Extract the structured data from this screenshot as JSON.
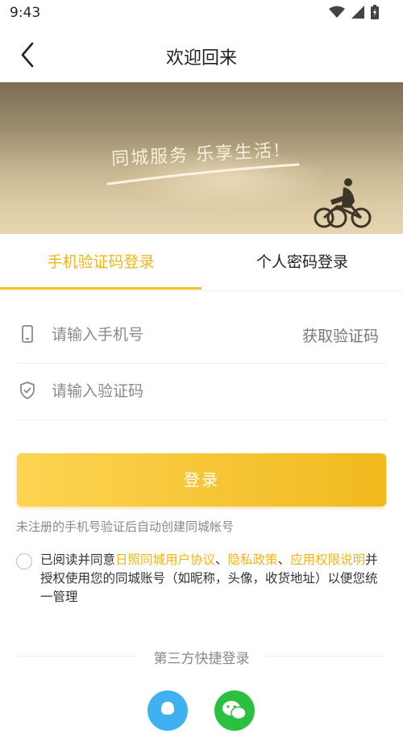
{
  "status_bar": {
    "time": "9:43"
  },
  "header": {
    "title": "欢迎回来"
  },
  "banner": {
    "slogan": "同城服务  乐享生活!"
  },
  "tabs": [
    {
      "label": "手机验证码登录",
      "active": true
    },
    {
      "label": "个人密码登录",
      "active": false
    }
  ],
  "form": {
    "phone_placeholder": "请输入手机号",
    "get_code_label": "获取验证码",
    "code_placeholder": "请输入验证码",
    "login_label": "登录",
    "hint": "未注册的手机号验证后自动创建同城帐号"
  },
  "agreement": {
    "prefix": "已阅读并同意",
    "link_user_agreement": "日照同城用户协议",
    "sep1": "、",
    "link_privacy": "隐私政策",
    "sep2": "、",
    "link_permissions": "应用权限说明",
    "suffix": "并授权使用您的同城账号（如昵称，头像，收货地址）以便您统一管理"
  },
  "third_party": {
    "title": "第三方快捷登录",
    "providers": [
      {
        "icon": "qq-icon"
      },
      {
        "icon": "wechat-icon"
      }
    ]
  },
  "colors": {
    "accent": "#f0b515",
    "button_start": "#fcd452",
    "button_end": "#f1b91e"
  }
}
